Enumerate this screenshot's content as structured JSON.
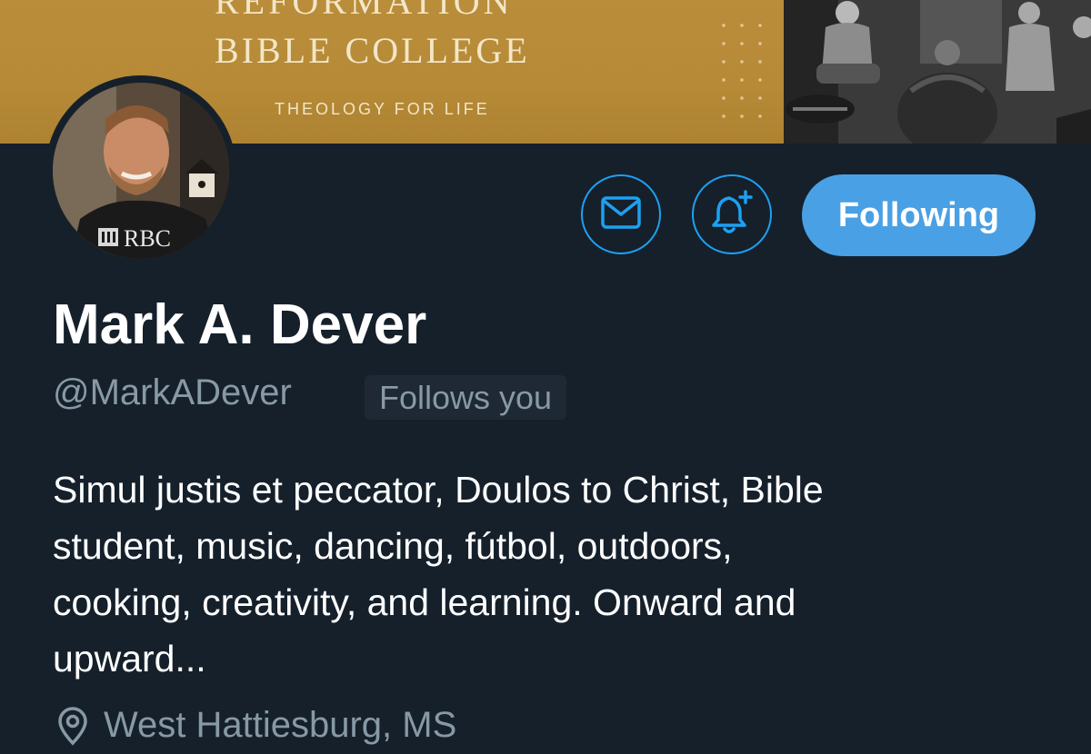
{
  "banner": {
    "title_line1": "REFORMATION",
    "title_line2": "BIBLE COLLEGE",
    "tagline": "THEOLOGY FOR LIFE"
  },
  "avatar": {
    "shirt_text": "RBC"
  },
  "actions": {
    "message_icon": "envelope-icon",
    "notify_icon": "bell-plus-icon",
    "follow_label": "Following",
    "accent_color": "#1da1f2",
    "follow_bg": "#4aa0e4"
  },
  "profile": {
    "name": "Mark A. Dever",
    "handle": "@MarkADever",
    "follows_you": "Follows you",
    "bio_lines": [
      "Simul justis et peccator, Doulos to Christ, Bible",
      "student, music, dancing, fútbol, outdoors,",
      "cooking, creativity, and learning. Onward and",
      "upward..."
    ],
    "location_icon": "location-pin-icon",
    "location": "West Hattiesburg, MS"
  },
  "theme": {
    "background": "#15202b",
    "secondary_text": "#8899a6"
  }
}
